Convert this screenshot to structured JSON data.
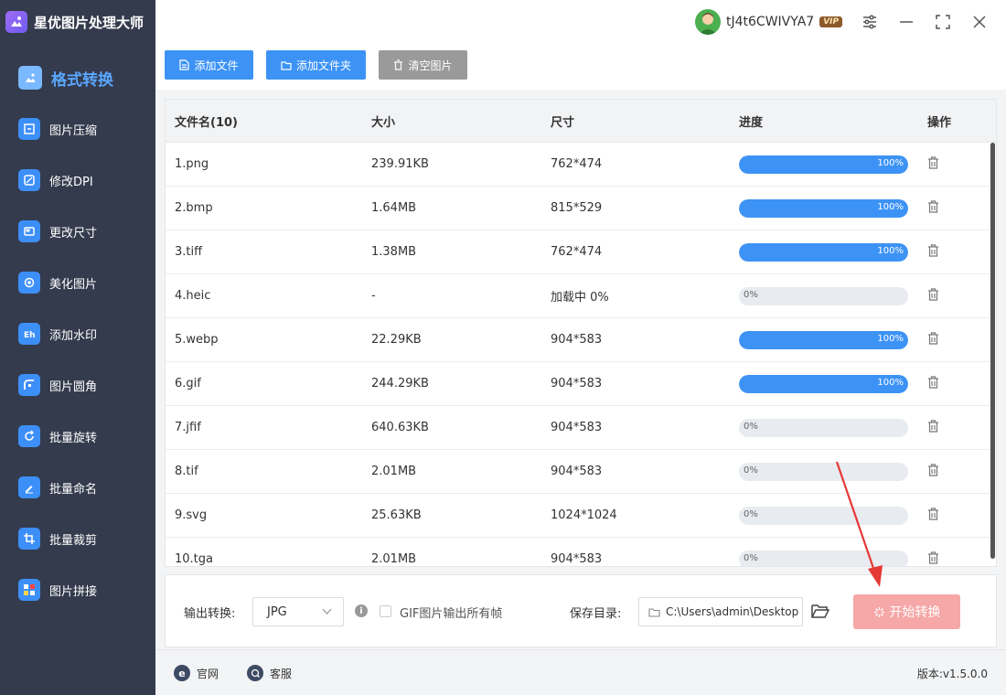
{
  "app": {
    "title": "星优图片处理大师"
  },
  "user": {
    "name": "tJ4t6CWIVYA7",
    "badge": "VIP"
  },
  "sidebar": {
    "items": [
      {
        "label": "格式转换",
        "icon": "image-convert-icon",
        "active": true
      },
      {
        "label": "图片压缩",
        "icon": "compress-icon"
      },
      {
        "label": "修改DPI",
        "icon": "dpi-icon"
      },
      {
        "label": "更改尺寸",
        "icon": "resize-icon"
      },
      {
        "label": "美化图片",
        "icon": "beautify-icon"
      },
      {
        "label": "添加水印",
        "icon": "watermark-icon"
      },
      {
        "label": "图片圆角",
        "icon": "round-corner-icon"
      },
      {
        "label": "批量旋转",
        "icon": "rotate-icon"
      },
      {
        "label": "批量命名",
        "icon": "rename-icon"
      },
      {
        "label": "批量裁剪",
        "icon": "crop-icon"
      },
      {
        "label": "图片拼接",
        "icon": "stitch-icon"
      }
    ]
  },
  "toolbar": {
    "add_file": "添加文件",
    "add_folder": "添加文件夹",
    "clear": "清空图片"
  },
  "table": {
    "headers": {
      "name": "文件名(10)",
      "size": "大小",
      "dimensions": "尺寸",
      "progress": "进度",
      "actions": "操作"
    },
    "rows": [
      {
        "name": "1.png",
        "size": "239.91KB",
        "dim": "762*474",
        "progress": "100%"
      },
      {
        "name": "2.bmp",
        "size": "1.64MB",
        "dim": "815*529",
        "progress": "100%"
      },
      {
        "name": "3.tiff",
        "size": "1.38MB",
        "dim": "762*474",
        "progress": "100%"
      },
      {
        "name": "4.heic",
        "size": "-",
        "dim": "加载中 0%",
        "progress": "0%"
      },
      {
        "name": "5.webp",
        "size": "22.29KB",
        "dim": "904*583",
        "progress": "100%"
      },
      {
        "name": "6.gif",
        "size": "244.29KB",
        "dim": "904*583",
        "progress": "100%"
      },
      {
        "name": "7.jfif",
        "size": "640.63KB",
        "dim": "904*583",
        "progress": "0%"
      },
      {
        "name": "8.tif",
        "size": "2.01MB",
        "dim": "904*583",
        "progress": "0%"
      },
      {
        "name": "9.svg",
        "size": "25.63KB",
        "dim": "1024*1024",
        "progress": "0%"
      },
      {
        "name": "10.tga",
        "size": "2.01MB",
        "dim": "904*583",
        "progress": "0%"
      }
    ]
  },
  "bottom": {
    "output_label": "输出转换:",
    "format": "JPG",
    "gif_option": "GIF图片输出所有帧",
    "save_label": "保存目录:",
    "save_path": "C:\\Users\\admin\\Desktop",
    "start": "开始转换"
  },
  "footer": {
    "website": "官网",
    "service": "客服",
    "version": "版本:v1.5.0.0"
  },
  "colors": {
    "accent": "#3d93f5",
    "sidebar": "#343b4d",
    "start_button": "#f6a7a7"
  }
}
